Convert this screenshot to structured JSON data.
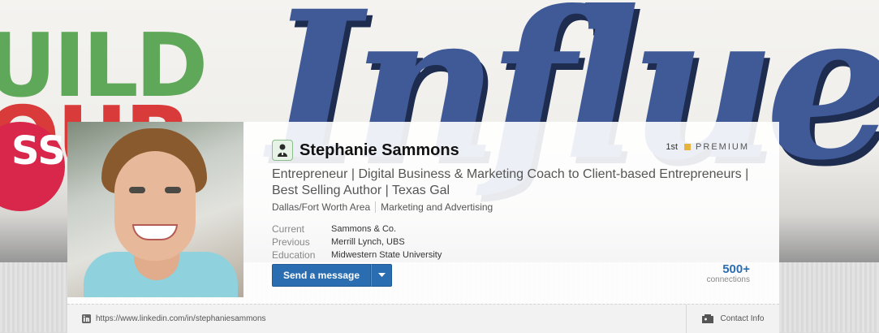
{
  "banner": {
    "line1": "UILD",
    "line2": "OUR",
    "circle_text": "SS",
    "script_word": "Influence"
  },
  "profile": {
    "name": "Stephanie Sammons",
    "degree": "1st",
    "premium_label": "PREMIUM",
    "headline": "Entrepreneur | Digital Business & Marketing Coach to Client-based Entrepreneurs | Best Selling Author | Texas Gal",
    "location": "Dallas/Fort Worth Area",
    "industry": "Marketing and Advertising",
    "facts": [
      {
        "label": "Current",
        "value": "Sammons & Co."
      },
      {
        "label": "Previous",
        "value": "Merrill Lynch, UBS"
      },
      {
        "label": "Education",
        "value": "Midwestern State University"
      }
    ],
    "send_button_label": "Send a message",
    "connections_count": "500+",
    "connections_label": "connections"
  },
  "footer": {
    "url": "https://www.linkedin.com/in/stephaniesammons",
    "contact_label": "Contact Info"
  },
  "colors": {
    "accent": "#2a6db0",
    "premium_gold": "#e6b33e",
    "banner_blue": "#3f5a96",
    "banner_green": "#5fa85a",
    "banner_red": "#d8274a"
  },
  "icons": {
    "name_badge": "profile-badge-icon",
    "dropdown": "chevron-down-icon",
    "url": "linkedin-icon",
    "contact": "contact-card-icon"
  }
}
